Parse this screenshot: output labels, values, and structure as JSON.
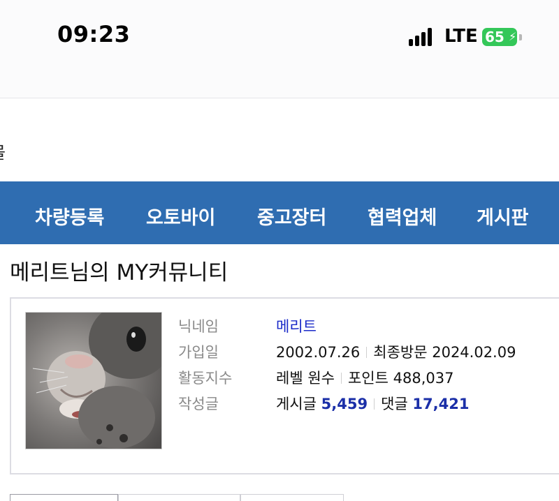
{
  "status_bar": {
    "time": "09:23",
    "network": "LTE",
    "battery_percent": "65",
    "battery_color": "#34c759"
  },
  "breadcrumb_fragment": "몰",
  "nav": {
    "background": "#2f6db1",
    "items": [
      {
        "label": "차량등록"
      },
      {
        "label": "오토바이"
      },
      {
        "label": "중고장터"
      },
      {
        "label": "협력업체"
      },
      {
        "label": "게시판"
      }
    ]
  },
  "page_title": "메리트님의 MY커뮤니티",
  "profile": {
    "nickname_label": "닉네임",
    "nickname": "메리트",
    "joined_label": "가입일",
    "joined_date": "2002.07.26",
    "last_visit_label": "최종방문",
    "last_visit_date": "2024.02.09",
    "activity_label": "활동지수",
    "level_label": "레벨",
    "level_value": "원수",
    "points_label": "포인트",
    "points_value": "488,037",
    "posts_label": "작성글",
    "post_count_label": "게시글",
    "post_count": "5,459",
    "comment_count_label": "댓글",
    "comment_count": "17,421",
    "avatar_icon": "rabbit-photo"
  }
}
